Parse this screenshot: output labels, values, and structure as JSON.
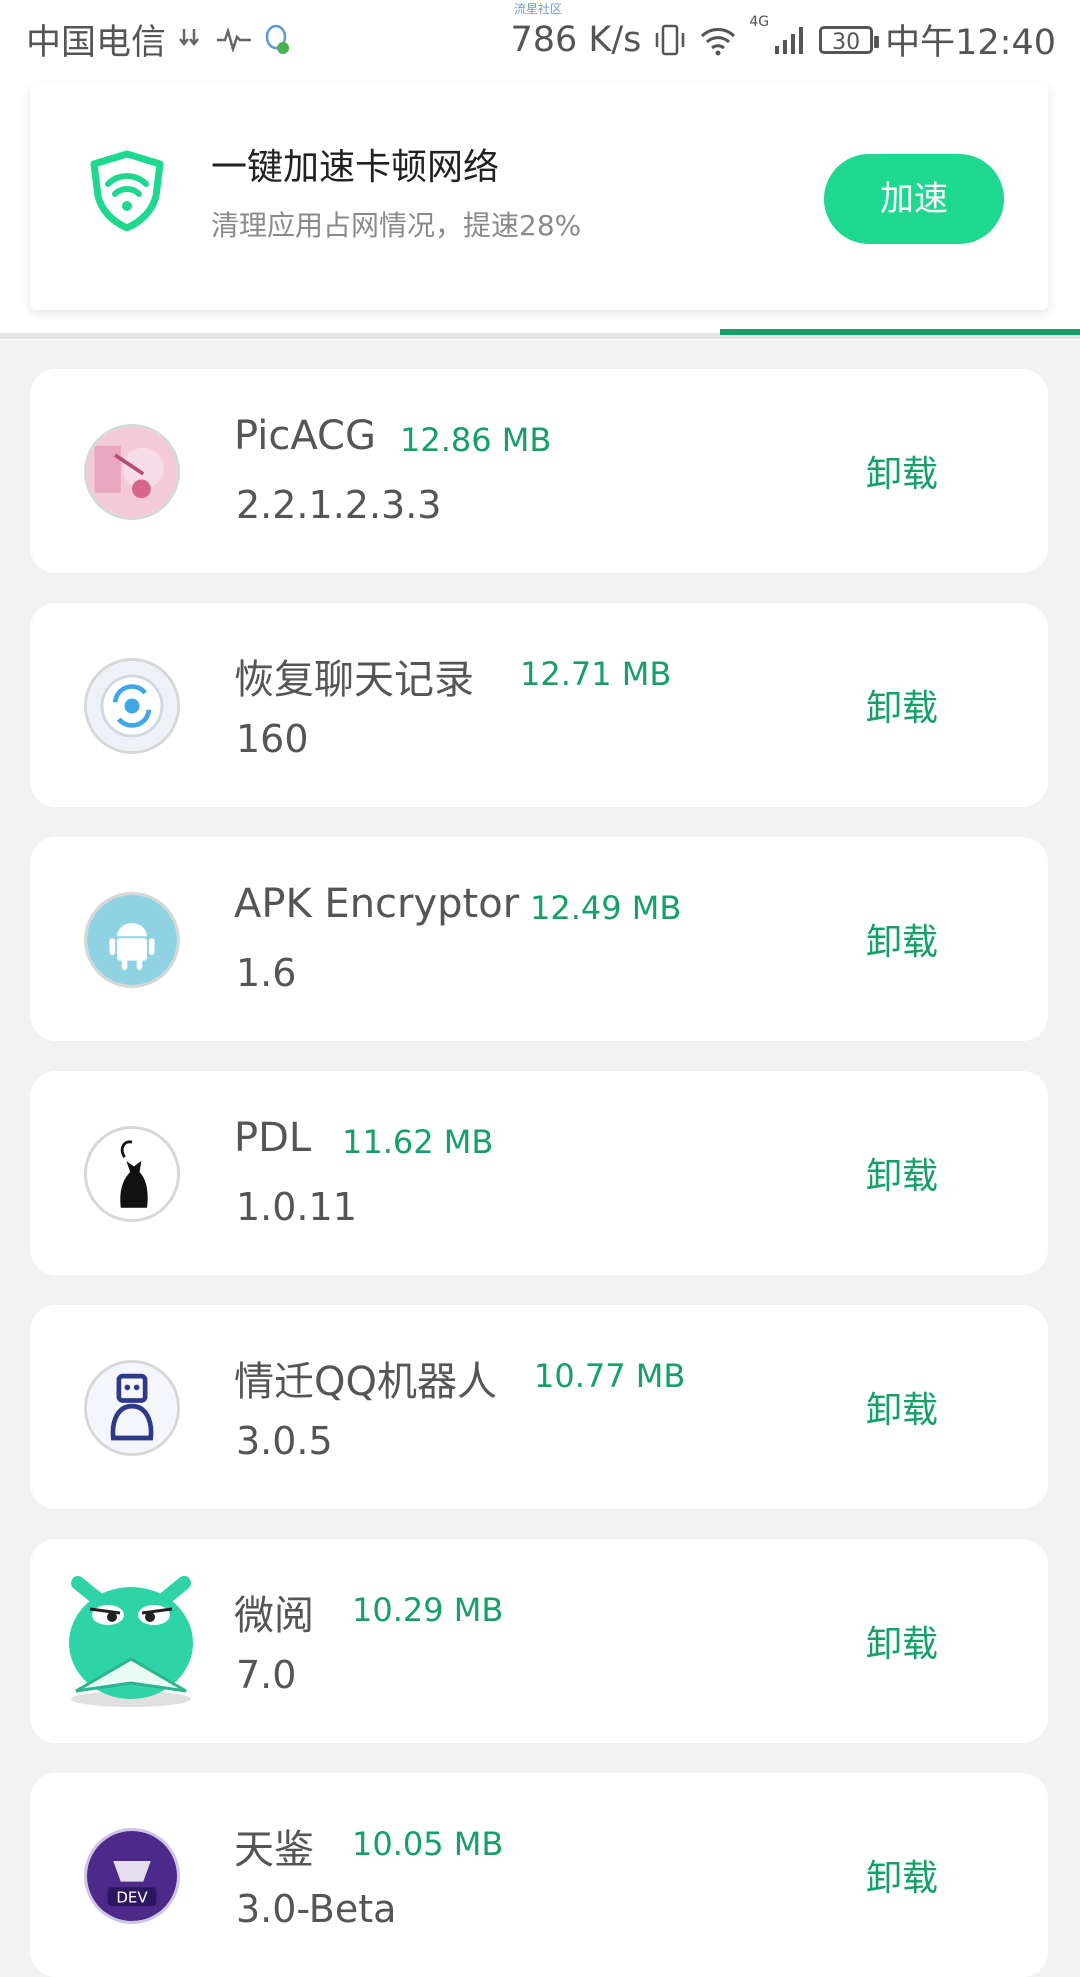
{
  "status_bar": {
    "carrier": "中国电信",
    "tiny_label": "流星社区",
    "speed": "786 K/s",
    "network": "4G",
    "battery": "30",
    "time": "中午12:40"
  },
  "promo": {
    "title": "一键加速卡顿网络",
    "subtitle": "清理应用占网情况，提速28%",
    "button": "加速",
    "brand_color": "#1ed890"
  },
  "apps": [
    {
      "name": "PicACG",
      "size": "12.86 MB",
      "version": "2.2.1.2.3.3",
      "action": "卸载",
      "icon": "picacg-icon"
    },
    {
      "name": "恢复聊天记录",
      "size": "12.71 MB",
      "version": "160",
      "action": "卸载",
      "icon": "recover-chat-icon"
    },
    {
      "name": "APK Encryptor",
      "size": "12.49 MB",
      "version": "1.6",
      "action": "卸载",
      "icon": "android-icon"
    },
    {
      "name": "PDL",
      "size": "11.62 MB",
      "version": "1.0.11",
      "action": "卸载",
      "icon": "black-cat-icon"
    },
    {
      "name": "情迁QQ机器人",
      "size": "10.77 MB",
      "version": "3.0.5",
      "action": "卸载",
      "icon": "robot-icon"
    },
    {
      "name": "微阅",
      "size": "10.29 MB",
      "version": "7.0",
      "action": "卸载",
      "icon": "weiyue-monster-icon"
    },
    {
      "name": "天鉴",
      "size": "10.05 MB",
      "version": "3.0-Beta",
      "action": "卸载",
      "icon": "dev-icon"
    }
  ],
  "accent_color": "#15a068"
}
